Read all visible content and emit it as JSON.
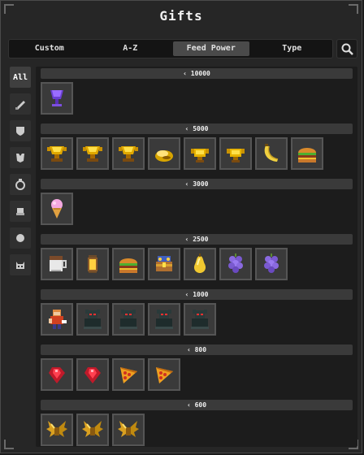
{
  "title": "Gifts",
  "tabs": [
    {
      "label": "Custom",
      "active": false
    },
    {
      "label": "A-Z",
      "active": false
    },
    {
      "label": "Feed Power",
      "active": true
    },
    {
      "label": "Type",
      "active": false
    }
  ],
  "search": {
    "icon": "search-icon"
  },
  "sidebar": [
    {
      "label": "All",
      "icon": "",
      "active": true
    },
    {
      "label": "",
      "icon": "weapon-icon",
      "active": false
    },
    {
      "label": "",
      "icon": "shield-icon",
      "active": false
    },
    {
      "label": "",
      "icon": "armor-icon",
      "active": false
    },
    {
      "label": "",
      "icon": "ring-icon",
      "active": false
    },
    {
      "label": "",
      "icon": "food-icon",
      "active": false
    },
    {
      "label": "",
      "icon": "gem-icon",
      "active": false
    },
    {
      "label": "",
      "icon": "cat-icon",
      "active": false
    }
  ],
  "tiers": [
    {
      "label": "10000",
      "items": [
        "goblet-icon"
      ]
    },
    {
      "label": "5000",
      "items": [
        "gold-trophy-icon",
        "gold-trophy-icon",
        "gold-trophy-icon",
        "gold-nugget-icon",
        "gold-crown-icon",
        "gold-crown-icon",
        "banana-icon",
        "burger-icon"
      ]
    },
    {
      "label": "3000",
      "items": [
        "ice-cream-icon"
      ]
    },
    {
      "label": "2500",
      "items": [
        "mug-icon",
        "lantern-icon",
        "burger-icon",
        "treasure-icon",
        "pear-icon",
        "grapes-icon",
        "grapes-icon"
      ]
    },
    {
      "label": "1000",
      "items": [
        "hero-figure-icon",
        "dark-statue-icon",
        "dark-statue-icon",
        "dark-statue-icon",
        "dark-statue-icon"
      ]
    },
    {
      "label": "800",
      "items": [
        "ruby-icon",
        "ruby-icon",
        "pizza-icon",
        "pizza-icon"
      ]
    },
    {
      "label": "600",
      "items": [
        "gold-wings-icon",
        "gold-wings-icon",
        "gold-wings-icon"
      ]
    }
  ],
  "colors": {
    "background": "#262626",
    "content": "#1c1c1c",
    "header": "#3a3a3a",
    "active_tab": "#4a4a4a"
  }
}
